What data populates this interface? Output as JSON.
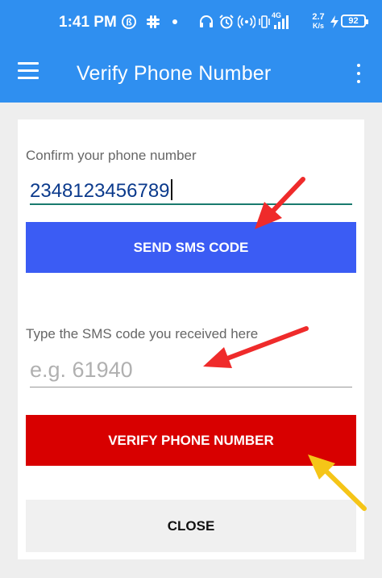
{
  "status_bar": {
    "time": "1:41 PM",
    "network_label": "4G",
    "speed_value": "2.7",
    "speed_unit": "K/s",
    "battery": "92",
    "icons": [
      "b-circle-icon",
      "slack-icon",
      "dot-icon",
      "headphones-icon",
      "alarm-icon",
      "hotspot-icon",
      "vibrate-icon",
      "signal-icon",
      "charging-icon",
      "battery-icon"
    ]
  },
  "app_bar": {
    "title": "Verify Phone Number",
    "menu_icon": "menu-icon",
    "overflow_icon": "overflow-menu-icon"
  },
  "form": {
    "phone": {
      "label": "Confirm your phone number",
      "value": "2348123456789"
    },
    "send_button": "SEND SMS CODE",
    "code": {
      "label": "Type the SMS code you received here",
      "placeholder": "e.g. 61940"
    },
    "verify_button": "VERIFY PHONE NUMBER",
    "close_button": "CLOSE"
  },
  "annotations": {
    "red_arrow_color": "#ef2b2b",
    "yellow_arrow_color": "#f5c518"
  },
  "colors": {
    "app_bar": "#2f8ff0",
    "send_button": "#3b5cf4",
    "verify_button": "#d80000",
    "close_button": "#f0f0f0",
    "input_focus": "#1a7a6e"
  }
}
